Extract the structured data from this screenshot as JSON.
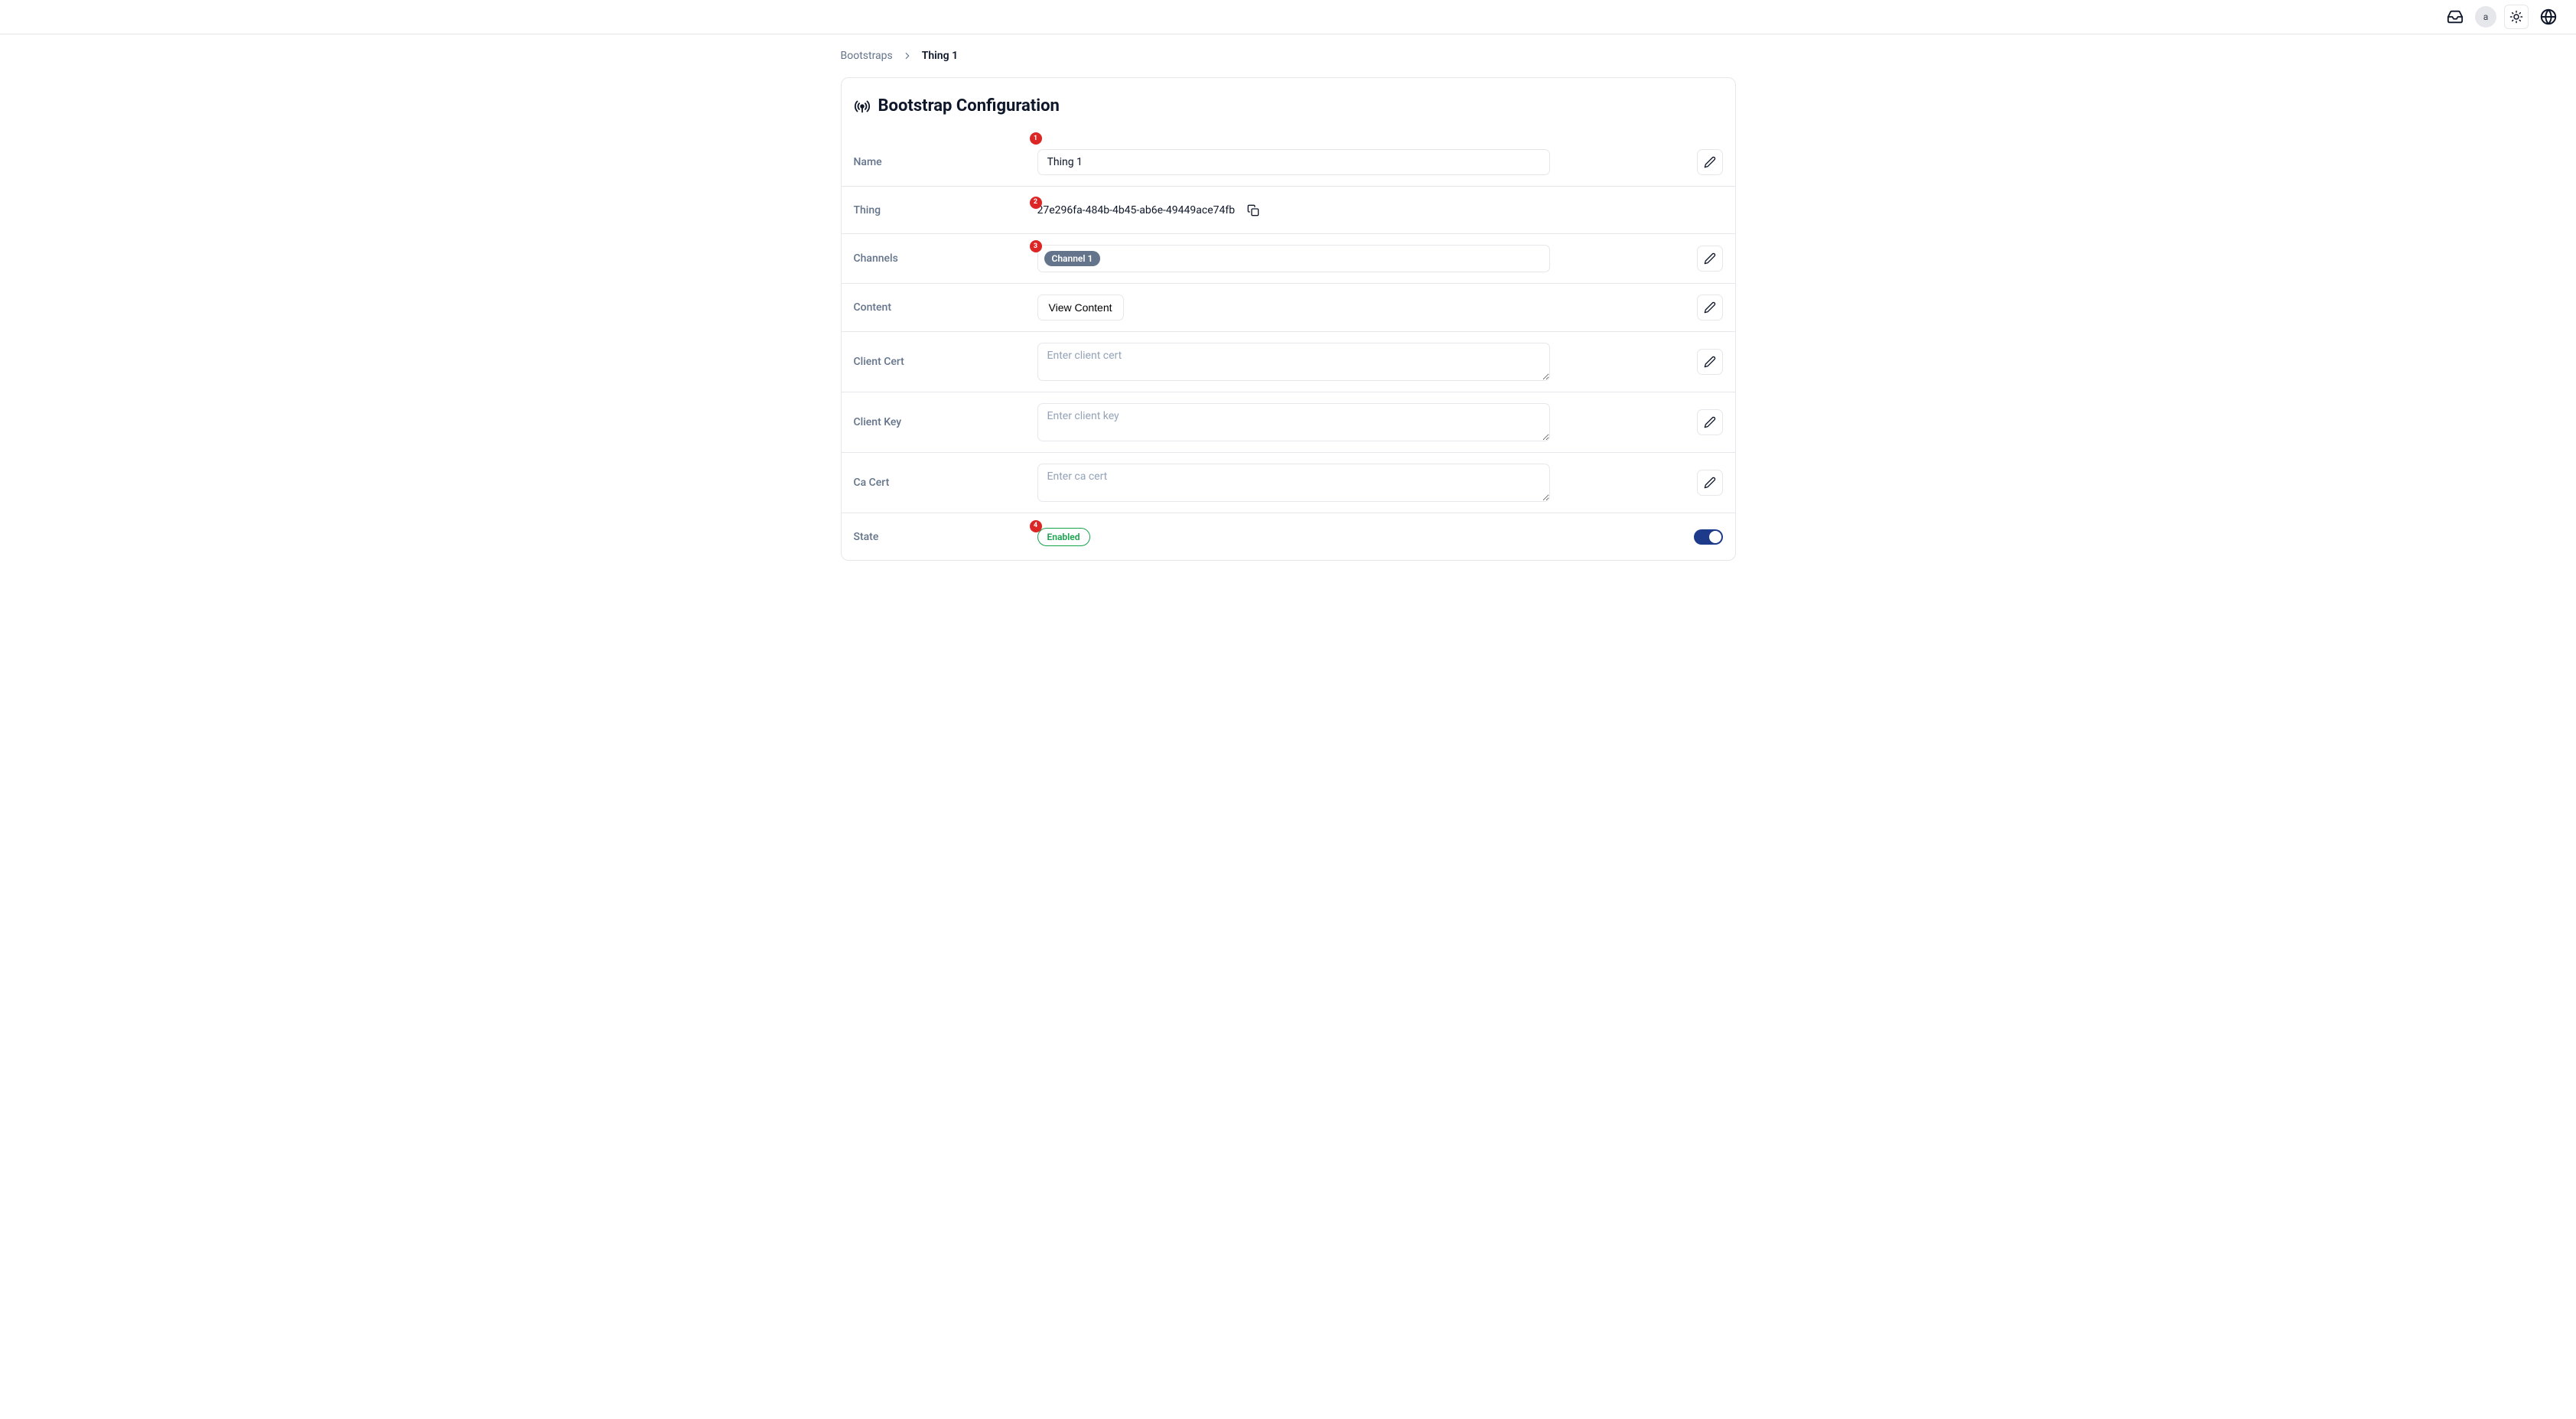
{
  "topbar": {
    "avatar_initial": "a"
  },
  "breadcrumb": {
    "root": "Bootstraps",
    "current": "Thing 1"
  },
  "card": {
    "title": "Bootstrap Configuration"
  },
  "markers": {
    "name": "1",
    "thing": "2",
    "channels": "3",
    "state": "4"
  },
  "labels": {
    "name": "Name",
    "thing": "Thing",
    "channels": "Channels",
    "content": "Content",
    "client_cert": "Client Cert",
    "client_key": "Client Key",
    "ca_cert": "Ca Cert",
    "state": "State"
  },
  "fields": {
    "name_value": "Thing 1",
    "thing_id": "27e296fa-484b-4b45-ab6e-49449ace74fb",
    "channels": [
      "Channel 1"
    ],
    "view_content_label": "View Content",
    "client_cert_value": "",
    "client_cert_placeholder": "Enter client cert",
    "client_key_value": "",
    "client_key_placeholder": "Enter client key",
    "ca_cert_value": "",
    "ca_cert_placeholder": "Enter ca cert",
    "state_label": "Enabled",
    "state_on": true
  }
}
